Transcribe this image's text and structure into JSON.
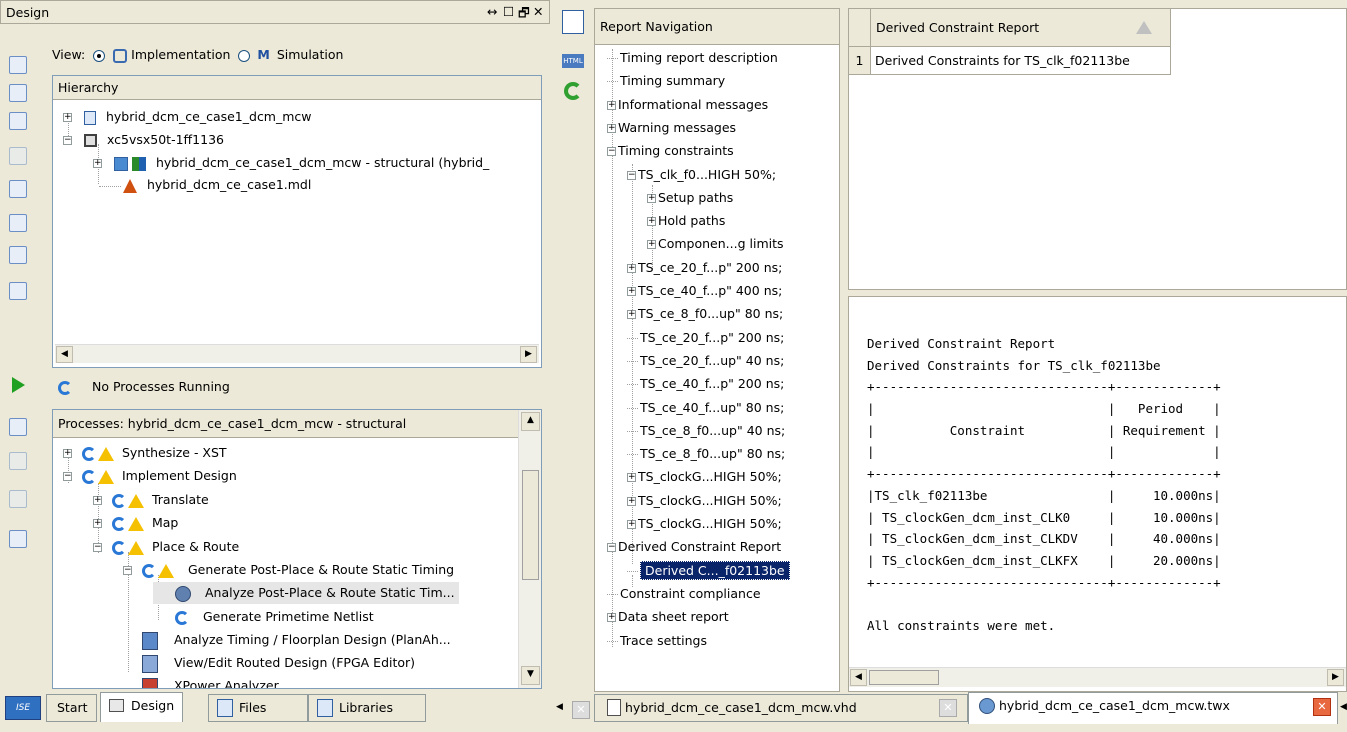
{
  "design_panel": {
    "title": "Design",
    "window_controls": [
      "↔",
      "☐",
      "🗗",
      "✕"
    ],
    "view_label": "View:",
    "view_options": [
      {
        "label": "Implementation",
        "selected": true
      },
      {
        "label": "Simulation",
        "selected": false
      }
    ],
    "hierarchy_header": "Hierarchy",
    "hierarchy_items": [
      {
        "label": "hybrid_dcm_ce_case1_dcm_mcw",
        "expander": "+"
      },
      {
        "label": "xc5vsx50t-1ff1136",
        "expander": "−"
      },
      {
        "label": "hybrid_dcm_ce_case1_dcm_mcw - structural (hybrid_",
        "expander": "+"
      },
      {
        "label": "hybrid_dcm_ce_case1.mdl",
        "expander": ""
      }
    ]
  },
  "process_panel": {
    "status": "No Processes Running",
    "header": "Processes: hybrid_dcm_ce_case1_dcm_mcw - structural",
    "items": [
      {
        "label": "Synthesize - XST",
        "expander": "+"
      },
      {
        "label": "Implement Design",
        "expander": "−"
      },
      {
        "label": "Translate",
        "expander": "+"
      },
      {
        "label": "Map",
        "expander": "+"
      },
      {
        "label": "Place & Route",
        "expander": "−"
      },
      {
        "label": "Generate Post-Place & Route Static Timing",
        "expander": "−"
      },
      {
        "label": "Analyze Post-Place & Route Static Tim...",
        "expander": ""
      },
      {
        "label": "Generate Primetime Netlist",
        "expander": ""
      },
      {
        "label": "Analyze Timing / Floorplan Design (PlanAh...",
        "expander": ""
      },
      {
        "label": "View/Edit Routed Design (FPGA Editor)",
        "expander": ""
      },
      {
        "label": "XPower Analyzer",
        "expander": ""
      }
    ]
  },
  "bottom_tabs": [
    {
      "label": "Start"
    },
    {
      "label": "Design"
    },
    {
      "label": "Files"
    },
    {
      "label": "Libraries"
    }
  ],
  "report_nav": {
    "title": "Report Navigation",
    "items": [
      {
        "label": "Timing report description",
        "expander": ""
      },
      {
        "label": "Timing summary",
        "expander": ""
      },
      {
        "label": "Informational messages",
        "expander": "+"
      },
      {
        "label": "Warning messages",
        "expander": "+"
      },
      {
        "label": "Timing constraints",
        "expander": "−"
      },
      {
        "label": "TS_clk_f0...HIGH 50%;",
        "expander": "−"
      },
      {
        "label": "Setup paths",
        "expander": "+"
      },
      {
        "label": "Hold paths",
        "expander": "+"
      },
      {
        "label": "Componen...g limits",
        "expander": "+"
      },
      {
        "label": "TS_ce_20_f...p\" 200 ns;",
        "expander": "+"
      },
      {
        "label": "TS_ce_40_f...p\" 400 ns;",
        "expander": "+"
      },
      {
        "label": "TS_ce_8_f0...up\" 80 ns;",
        "expander": "+"
      },
      {
        "label": "TS_ce_20_f...p\" 200 ns;",
        "expander": ""
      },
      {
        "label": "TS_ce_20_f...up\" 40 ns;",
        "expander": ""
      },
      {
        "label": "TS_ce_40_f...p\" 200 ns;",
        "expander": ""
      },
      {
        "label": "TS_ce_40_f...up\" 80 ns;",
        "expander": ""
      },
      {
        "label": "TS_ce_8_f0...up\" 40 ns;",
        "expander": ""
      },
      {
        "label": "TS_ce_8_f0...up\" 80 ns;",
        "expander": ""
      },
      {
        "label": "TS_clockG...HIGH 50%;",
        "expander": "+"
      },
      {
        "label": "TS_clockG...HIGH 50%;",
        "expander": "+"
      },
      {
        "label": "TS_clockG...HIGH 50%;",
        "expander": "+"
      },
      {
        "label": "Derived Constraint Report",
        "expander": "−"
      },
      {
        "label": "Derived C..._f02113be",
        "expander": ""
      },
      {
        "label": "Constraint compliance",
        "expander": ""
      },
      {
        "label": "Data sheet report",
        "expander": "+"
      },
      {
        "label": "Trace settings",
        "expander": ""
      }
    ]
  },
  "derived_table": {
    "header": "Derived Constraint Report",
    "row_number": "1",
    "row_text": "Derived Constraints for TS_clk_f02113be"
  },
  "report_text": {
    "lines": [
      "Derived Constraint Report",
      "Derived Constraints for TS_clk_f02113be",
      "+-------------------------------+-------------+",
      "|                               |   Period    |",
      "|          Constraint           | Requirement |",
      "|                               |             |",
      "+-------------------------------+-------------+",
      "|TS_clk_f02113be                |     10.000ns|",
      "| TS_clockGen_dcm_inst_CLK0     |     10.000ns|",
      "| TS_clockGen_dcm_inst_CLKDV    |     40.000ns|",
      "| TS_clockGen_dcm_inst_CLKFX    |     20.000ns|",
      "+-------------------------------+-------------+",
      "",
      "All constraints were met."
    ]
  },
  "doc_tabs": [
    {
      "label": "hybrid_dcm_ce_case1_dcm_mcw.vhd"
    },
    {
      "label": "hybrid_dcm_ce_case1_dcm_mcw.twx"
    }
  ]
}
